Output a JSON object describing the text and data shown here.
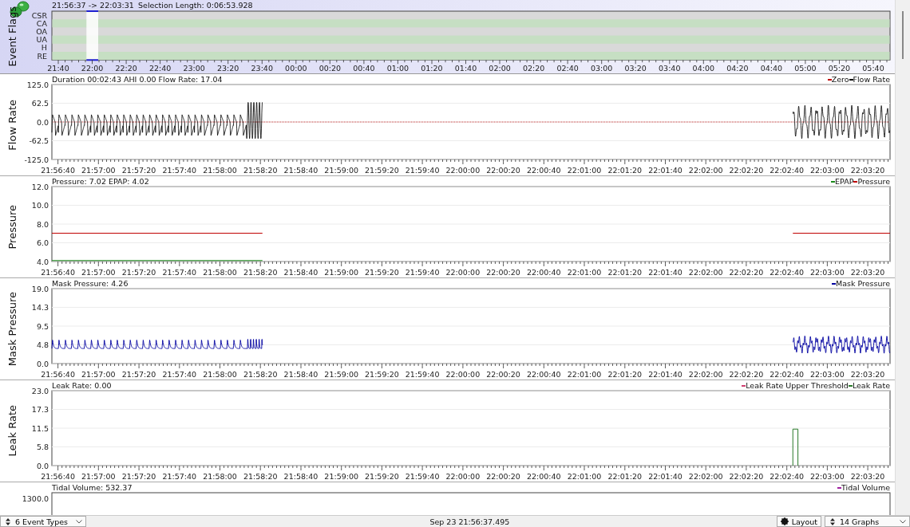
{
  "event_flags": {
    "title": "Event Flags",
    "range": "21:56:37 -> 22:03:31",
    "selection_length": "Selection Length: 0:06:53.928",
    "flags": [
      {
        "label": "CSR"
      },
      {
        "label": "CA"
      },
      {
        "label": "OA"
      },
      {
        "label": "UA"
      },
      {
        "label": "H"
      },
      {
        "label": "RE"
      }
    ],
    "x_ticks": [
      "21:40",
      "22:00",
      "22:20",
      "22:40",
      "23:00",
      "23:20",
      "23:40",
      "00:00",
      "00:20",
      "00:40",
      "01:00",
      "01:20",
      "01:40",
      "02:00",
      "02:20",
      "02:40",
      "03:00",
      "03:20",
      "03:40",
      "04:00",
      "04:20",
      "04:40",
      "05:00",
      "05:20",
      "05:40"
    ]
  },
  "graphs": [
    {
      "title": "Flow Rate",
      "kind": "flow",
      "info": "Duration 00:02:43 AHI 0.00 Flow Rate: 17.04",
      "legend": [
        {
          "label": "Zero",
          "color": "#c00000"
        },
        {
          "label": "Flow Rate",
          "color": "#000000"
        }
      ],
      "y_ticks": [
        "125.0",
        "62.5",
        "0.0",
        "-62.5",
        "-125.0"
      ],
      "x_ticks": [
        "21:56:40",
        "21:57:00",
        "21:57:20",
        "21:57:40",
        "21:58:00",
        "21:58:20",
        "21:58:40",
        "21:59:00",
        "21:59:20",
        "21:59:40",
        "22:00:00",
        "22:00:20",
        "22:00:40",
        "22:01:00",
        "22:01:20",
        "22:01:40",
        "22:02:00",
        "22:02:20",
        "22:02:40",
        "22:03:00",
        "22:03:20"
      ]
    },
    {
      "title": "Pressure",
      "kind": "pressure",
      "info": "Pressure: 7.02 EPAP: 4.02",
      "legend": [
        {
          "label": "EPAP",
          "color": "#1a8a1a"
        },
        {
          "label": "Pressure",
          "color": "#c00000"
        }
      ],
      "y_ticks": [
        "12.0",
        "10.0",
        "8.0",
        "6.0",
        "4.0"
      ],
      "x_ticks": [
        "21:56:40",
        "21:57:00",
        "21:57:20",
        "21:57:40",
        "21:58:00",
        "21:58:20",
        "21:58:40",
        "21:59:00",
        "21:59:20",
        "21:59:40",
        "22:00:00",
        "22:00:20",
        "22:00:40",
        "22:01:00",
        "22:01:20",
        "22:01:40",
        "22:02:00",
        "22:02:20",
        "22:02:40",
        "22:03:00",
        "22:03:20"
      ]
    },
    {
      "title": "Mask Pressure",
      "kind": "mask",
      "info": "Mask Pressure: 4.26",
      "legend": [
        {
          "label": "Mask Pressure",
          "color": "#0000a0"
        }
      ],
      "y_ticks": [
        "19.0",
        "14.3",
        "9.5",
        "4.8",
        "0.0"
      ],
      "x_ticks": [
        "21:56:40",
        "21:57:00",
        "21:57:20",
        "21:57:40",
        "21:58:00",
        "21:58:20",
        "21:58:40",
        "21:59:00",
        "21:59:20",
        "21:59:40",
        "22:00:00",
        "22:00:20",
        "22:00:40",
        "22:01:00",
        "22:01:20",
        "22:01:40",
        "22:02:00",
        "22:02:20",
        "22:02:40",
        "22:03:00",
        "22:03:20"
      ]
    },
    {
      "title": "Leak Rate",
      "kind": "leak",
      "info": "Leak Rate: 0.00",
      "legend": [
        {
          "label": "Leak Rate Upper Threshold",
          "color": "#d04070"
        },
        {
          "label": "Leak Rate",
          "color": "#2a7a2a"
        }
      ],
      "y_ticks": [
        "23.0",
        "17.3",
        "11.5",
        "5.8",
        "0.0"
      ],
      "x_ticks": [
        "21:56:40",
        "21:57:00",
        "21:57:20",
        "21:57:40",
        "21:58:00",
        "21:58:20",
        "21:58:40",
        "21:59:00",
        "21:59:20",
        "21:59:40",
        "22:00:00",
        "22:00:20",
        "22:00:40",
        "22:01:00",
        "22:01:20",
        "22:01:40",
        "22:02:00",
        "22:02:20",
        "22:02:40",
        "22:03:00",
        "22:03:20"
      ]
    },
    {
      "kind": "none",
      "info": "Tidal Volume: 532.37",
      "legend": [
        {
          "label": "Tidal Volume",
          "color": "#a020a0"
        }
      ],
      "y_ticks": [
        "1300.0"
      ]
    }
  ],
  "status_bar": {
    "event_types": "6 Event Types",
    "timestamp": "Sep 23 21:56:37.495",
    "layout": "Layout",
    "graphs": "14 Graphs"
  }
}
